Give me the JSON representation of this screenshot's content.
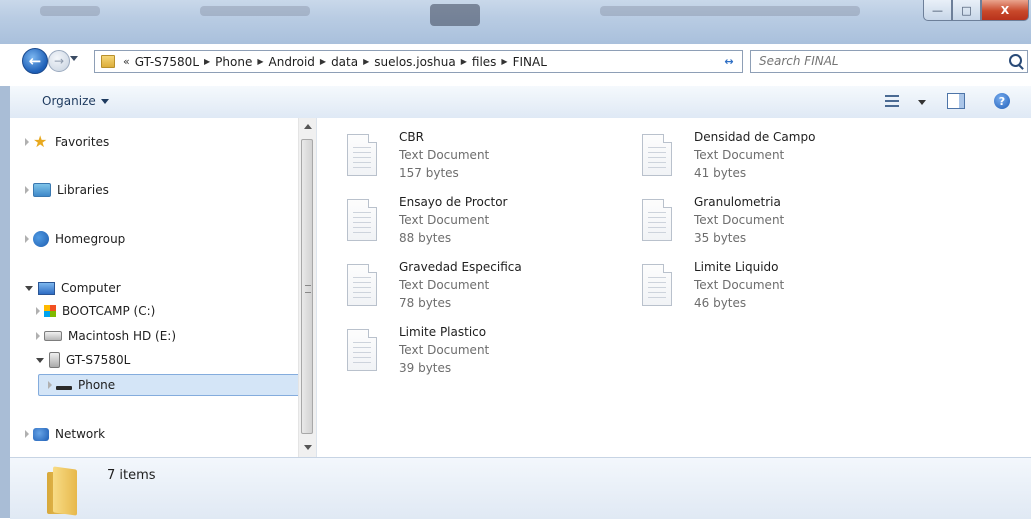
{
  "window": {
    "controls": {
      "minimize_icon": "minimize-icon",
      "maximize_icon": "maximize-icon",
      "close_icon": "close-icon",
      "min_glyph": "—",
      "max_glyph": "□",
      "close_glyph": "X"
    }
  },
  "address_bar": {
    "overflow_chevron": "«",
    "separator_glyph": "▶",
    "breadcrumb": [
      "GT-S7580L",
      "Phone",
      "Android",
      "data",
      "suelos.joshua",
      "files",
      "FINAL"
    ],
    "refresh_glyph": "↔"
  },
  "search": {
    "placeholder": "Search FINAL"
  },
  "toolbar": {
    "organize_label": "Organize"
  },
  "navigation": {
    "items": [
      {
        "label": "Favorites",
        "icon": "star-icon"
      },
      {
        "label": "Libraries",
        "icon": "libraries-icon"
      },
      {
        "label": "Homegroup",
        "icon": "homegroup-icon"
      },
      {
        "label": "Computer",
        "icon": "computer-icon"
      },
      {
        "label": "BOOTCAMP (C:)",
        "icon": "windows-drive-icon"
      },
      {
        "label": "Macintosh HD (E:)",
        "icon": "drive-icon"
      },
      {
        "label": "GT-S7580L",
        "icon": "phone-icon"
      },
      {
        "label": "Phone",
        "icon": "device-storage-icon",
        "selected": true
      },
      {
        "label": "Network",
        "icon": "network-icon"
      }
    ]
  },
  "files": [
    {
      "name": "CBR",
      "type": "Text Document",
      "size": "157 bytes"
    },
    {
      "name": "Densidad de Campo",
      "type": "Text Document",
      "size": "41 bytes"
    },
    {
      "name": "Ensayo de Proctor",
      "type": "Text Document",
      "size": "88 bytes"
    },
    {
      "name": "Granulometria",
      "type": "Text Document",
      "size": "35 bytes"
    },
    {
      "name": "Gravedad Especifica",
      "type": "Text Document",
      "size": "78 bytes"
    },
    {
      "name": "Limite Liquido",
      "type": "Text Document",
      "size": "46 bytes"
    },
    {
      "name": "Limite Plastico",
      "type": "Text Document",
      "size": "39 bytes"
    }
  ],
  "details": {
    "item_count": "7 items"
  }
}
